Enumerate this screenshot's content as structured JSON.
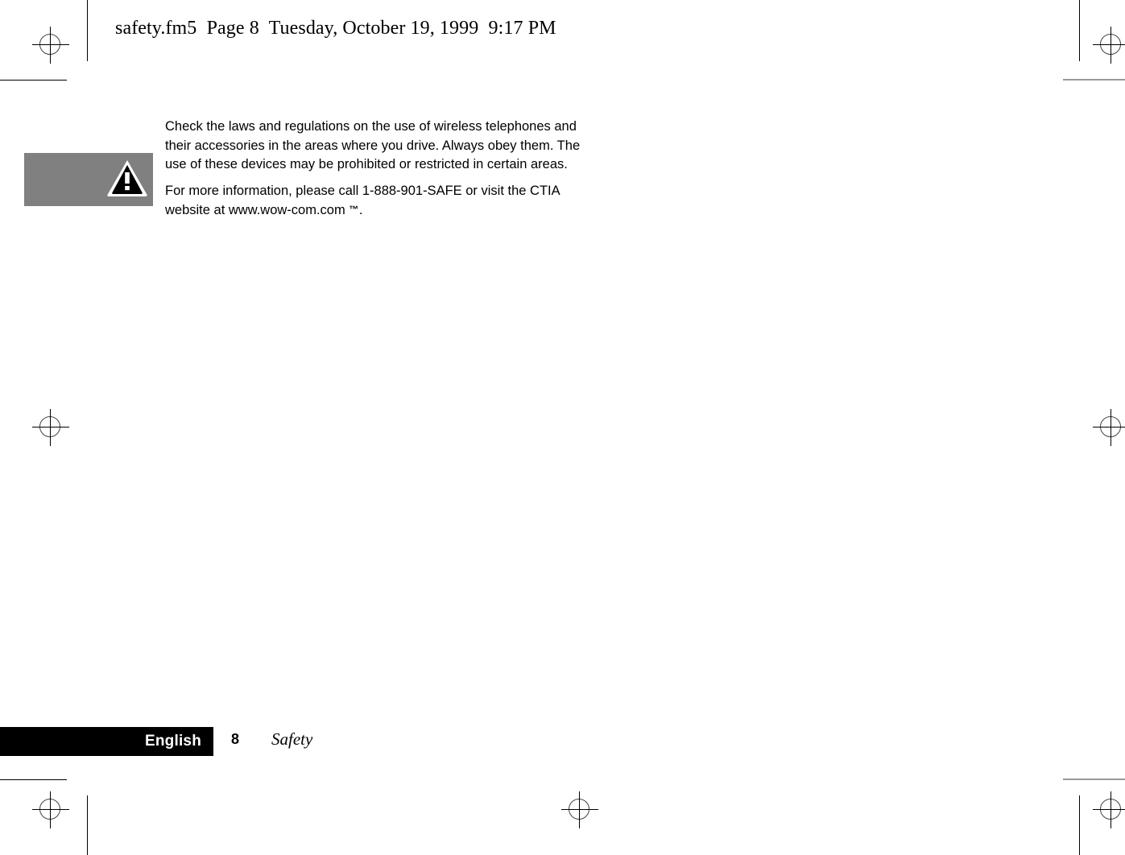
{
  "page_stamp": "safety.fm5  Page 8  Tuesday, October 19, 1999  9:17 PM",
  "note": {
    "icon_name": "warning-triangle-icon",
    "background_color": "#808080",
    "paragraphs": [
      "Check the laws and regulations on the use of wireless telephones and their accessories in the areas where you drive. Always obey them. The use of these devices may be prohibited or restricted in certain areas.",
      "For more information, please call 1-888-901-SAFE or visit the CTIA website at www.wow-com.com "
    ],
    "trademark_symbol": "™",
    "trailing_punctuation": "."
  },
  "footer": {
    "language_label": "English",
    "page_number": "8",
    "section_label": "Safety",
    "bar_color": "#000000",
    "language_text_color": "#ffffff"
  },
  "print_marks": {
    "registration_mark_name": "registration-crosshair-mark",
    "crop_line_name": "crop-mark-line",
    "count": 7
  }
}
